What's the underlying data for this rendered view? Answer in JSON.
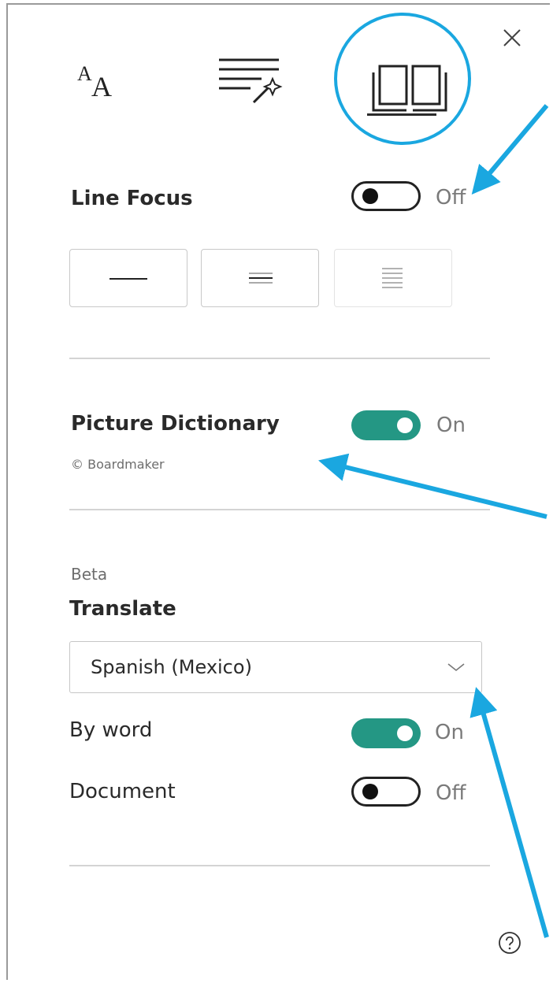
{
  "panel": {
    "tabs": [
      {
        "name": "text-preferences",
        "icon": "text-size-icon"
      },
      {
        "name": "grammar-options",
        "icon": "grammar-magic-icon"
      },
      {
        "name": "reading-preferences",
        "icon": "book-icon",
        "active": true
      }
    ],
    "close_icon": "close-icon",
    "help_icon": "help-icon"
  },
  "line_focus": {
    "label": "Line Focus",
    "state": "Off",
    "options": [
      "one-line-icon",
      "three-lines-icon",
      "five-lines-icon"
    ]
  },
  "picture_dictionary": {
    "label": "Picture Dictionary",
    "state": "On",
    "credit": "© Boardmaker"
  },
  "translate": {
    "beta_label": "Beta",
    "label": "Translate",
    "language": "Spanish (Mexico)",
    "by_word": {
      "label": "By word",
      "state": "On"
    },
    "document": {
      "label": "Document",
      "state": "Off"
    }
  },
  "colors": {
    "toggle_on": "#249784",
    "highlight": "#1aa7e0"
  }
}
